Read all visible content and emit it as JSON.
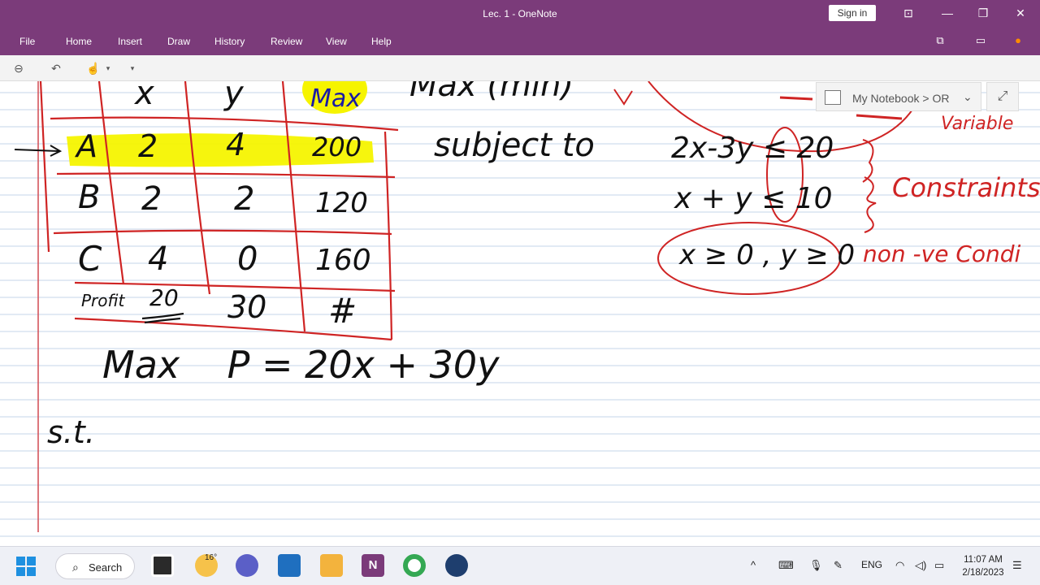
{
  "window": {
    "title": "Lec. 1  -  OneNote",
    "sign_in": "Sign in"
  },
  "menu": [
    "File",
    "Home",
    "Insert",
    "Draw",
    "History",
    "Review",
    "View",
    "Help"
  ],
  "notebook": {
    "path": "My Notebook > OR"
  },
  "note": {
    "table": {
      "headers": [
        "x",
        "y",
        "Max"
      ],
      "rows": [
        {
          "label": "A",
          "x": "2",
          "y": "4",
          "max": "200"
        },
        {
          "label": "B",
          "x": "2",
          "y": "2",
          "max": "120"
        },
        {
          "label": "C",
          "x": "4",
          "y": "0",
          "max": "160"
        }
      ],
      "profit_label": "Profit",
      "profit_x": "20",
      "profit_y": "30",
      "profit_max": "#"
    },
    "objective_top": "Max (min)",
    "subject_to": "subject to",
    "constraint1": "2x-3y ≤ 20",
    "constraint2": "x + y ≤ 10",
    "nonneg": "x ≥ 0 , y ≥ 0",
    "constraints_label": "Constraints",
    "variable_label": "Variable",
    "nonneg_label": "non -ve Condi",
    "objective": "Max    P = 20x + 30y",
    "st": "s.t."
  },
  "taskbar": {
    "search_label": "Search",
    "weather_temp": "16°",
    "language": "ENG",
    "time": "11:07 AM",
    "date": "2/18/2023"
  }
}
